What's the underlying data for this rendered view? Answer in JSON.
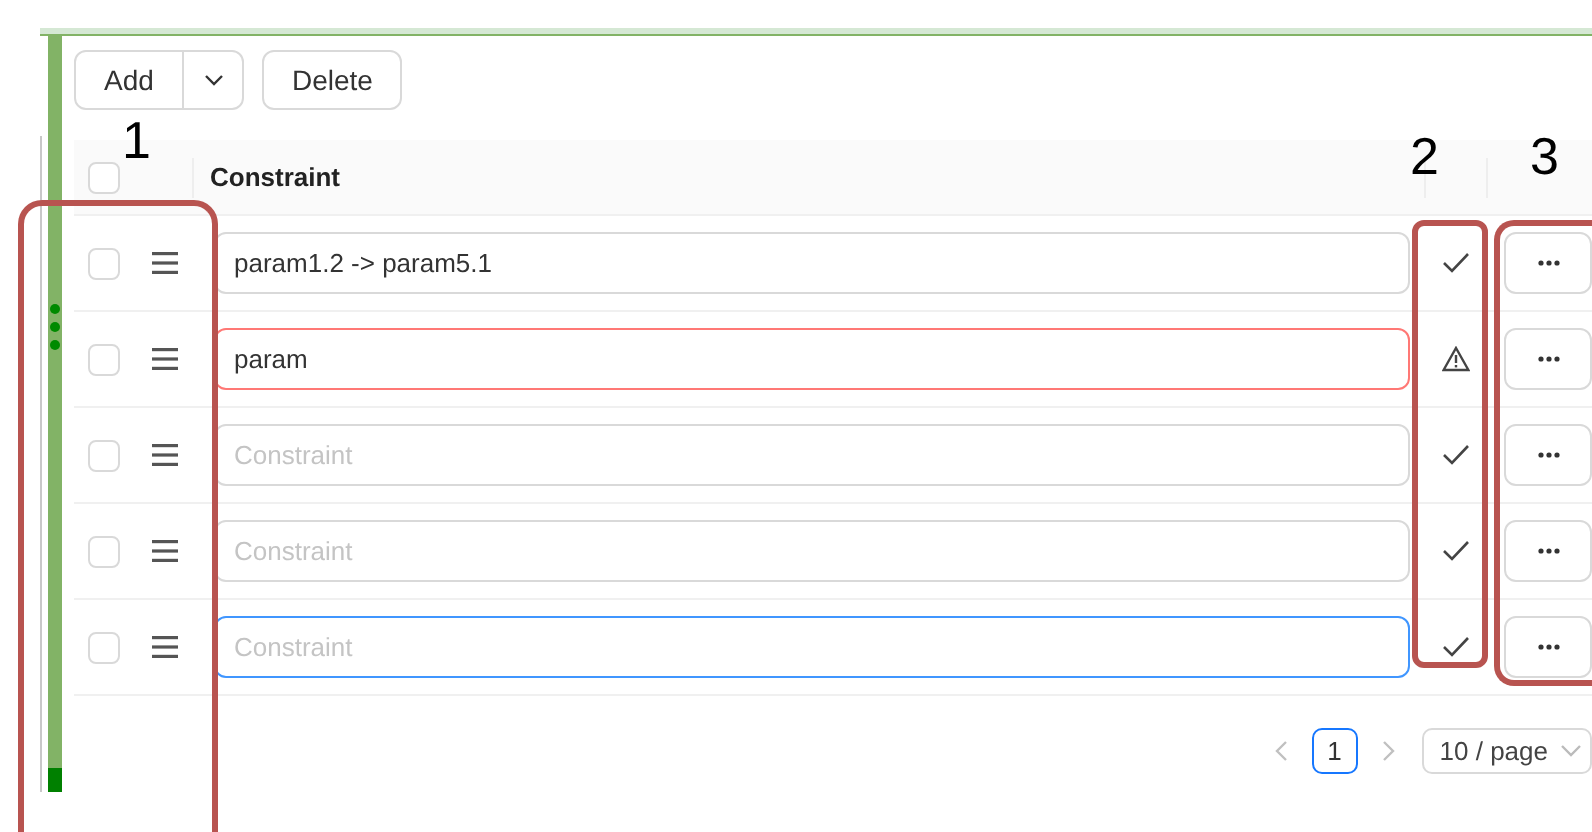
{
  "toolbar": {
    "add_button": "Add",
    "delete_button": "Delete"
  },
  "table": {
    "columns": [
      "Constraint"
    ],
    "header_checked": false,
    "rows": [
      {
        "checked": false,
        "value": "param1.2 -> param5.1",
        "invalid": false,
        "focused": false,
        "warning": false
      },
      {
        "checked": false,
        "value": "param",
        "invalid": true,
        "focused": false,
        "warning": true
      },
      {
        "checked": false,
        "placeholder": "Constraint",
        "invalid": false,
        "focused": false,
        "warning": false
      },
      {
        "checked": false,
        "placeholder": "Constraint",
        "invalid": false,
        "focused": false,
        "warning": false
      },
      {
        "checked": false,
        "placeholder": "Constraint",
        "invalid": false,
        "focused": true,
        "warning": false
      }
    ]
  },
  "pagination": {
    "current_page": "1",
    "page_size": "10 / page"
  },
  "annotations": [
    {
      "label": "1"
    },
    {
      "label": "2"
    },
    {
      "label": "3"
    }
  ]
}
